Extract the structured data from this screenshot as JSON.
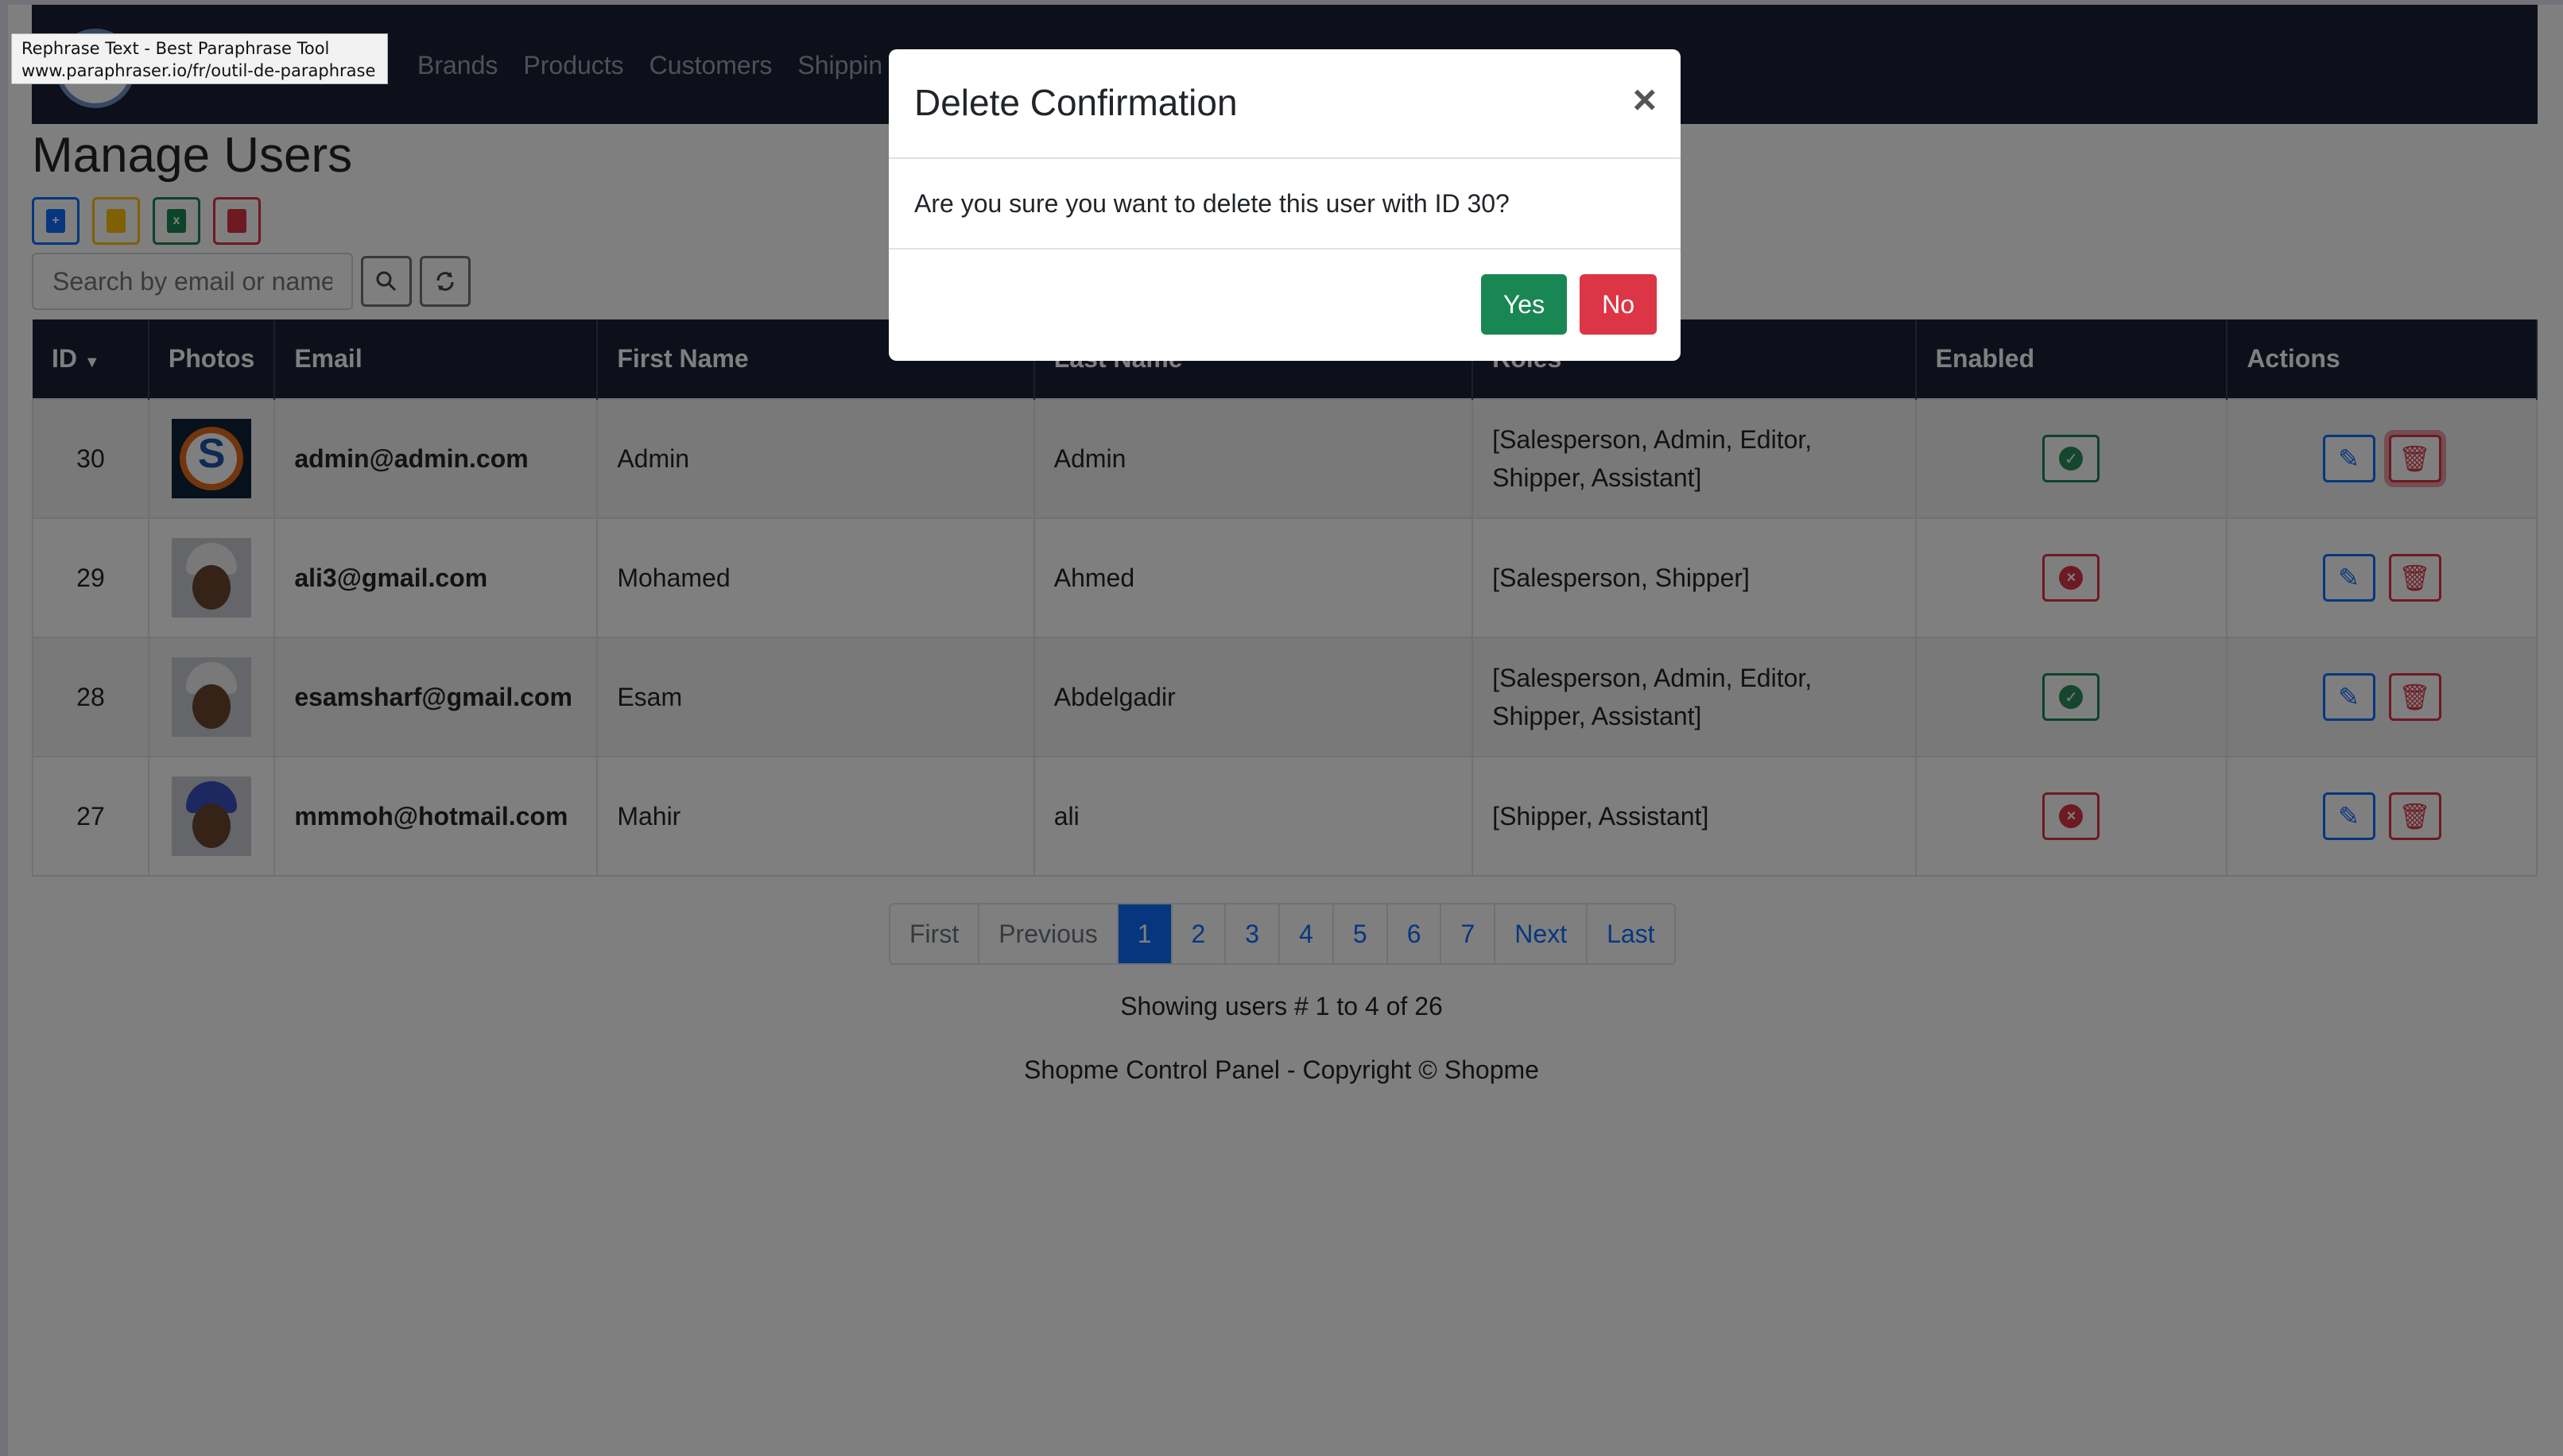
{
  "tooltip": {
    "line1": "Rephrase Text - Best Paraphrase Tool",
    "line2": "www.paraphraser.io/fr/outil-de-paraphrase"
  },
  "navbar": {
    "links": [
      "Brands",
      "Products",
      "Customers",
      "Shippin"
    ]
  },
  "page": {
    "title": "Manage Users",
    "search_placeholder": "Search by email or name"
  },
  "table": {
    "headers": [
      "ID",
      "Photos",
      "Email",
      "First Name",
      "Last Name",
      "Roles",
      "Enabled",
      "Actions"
    ],
    "rows": [
      {
        "id": "30",
        "photo": "logo",
        "email": "admin@admin.com",
        "first": "Admin",
        "last": "Admin",
        "roles": "[Salesperson, Admin, Editor, Shipper, Assistant]",
        "enabled": true
      },
      {
        "id": "29",
        "photo": "person-white-cap",
        "email": "ali3@gmail.com",
        "first": "Mohamed",
        "last": "Ahmed",
        "roles": "[Salesperson, Shipper]",
        "enabled": false
      },
      {
        "id": "28",
        "photo": "person-white-cap",
        "email": "esamsharf@gmail.com",
        "first": "Esam",
        "last": "Abdelgadir",
        "roles": "[Salesperson, Admin, Editor, Shipper, Assistant]",
        "enabled": true
      },
      {
        "id": "27",
        "photo": "person-blue-cap",
        "email": "mmmoh@hotmail.com",
        "first": "Mahir",
        "last": "ali",
        "roles": "[Shipper, Assistant]",
        "enabled": false
      }
    ]
  },
  "pagination": {
    "first": "First",
    "previous": "Previous",
    "pages": [
      "1",
      "2",
      "3",
      "4",
      "5",
      "6",
      "7"
    ],
    "next": "Next",
    "last": "Last",
    "active": "1"
  },
  "status": "Showing users # 1 to 4 of 26",
  "footer": "Shopme Control Panel - Copyright © Shopme",
  "modal": {
    "title": "Delete Confirmation",
    "close": "×",
    "body": "Are you sure you want to delete this user with ID 30?",
    "yes": "Yes",
    "no": "No"
  },
  "colors": {
    "navbar": "#1a2035",
    "primary": "#0d6efd",
    "success": "#198754",
    "danger": "#dc3545"
  }
}
